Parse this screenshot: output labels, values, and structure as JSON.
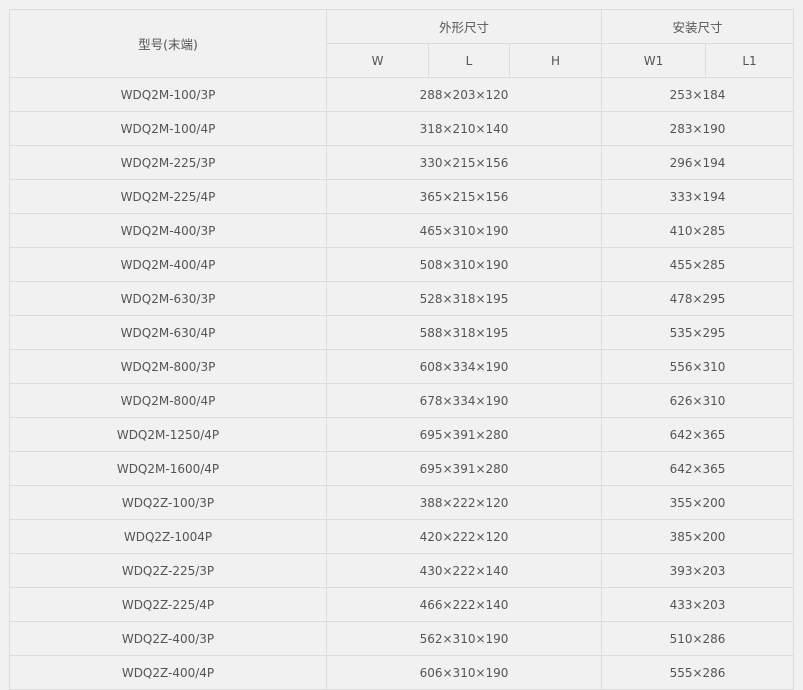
{
  "table": {
    "headers": {
      "model": "型号(末端)",
      "outer_dims": "外形尺寸",
      "install_dims": "安装尺寸",
      "w": "W",
      "l": "L",
      "h": "H",
      "w1": "W1",
      "l1": "L1"
    },
    "rows": [
      {
        "model": "WDQ2M-100/3P",
        "outer": "288×203×120",
        "install": "253×184"
      },
      {
        "model": "WDQ2M-100/4P",
        "outer": "318×210×140",
        "install": "283×190"
      },
      {
        "model": "WDQ2M-225/3P",
        "outer": "330×215×156",
        "install": "296×194"
      },
      {
        "model": "WDQ2M-225/4P",
        "outer": "365×215×156",
        "install": "333×194"
      },
      {
        "model": "WDQ2M-400/3P",
        "outer": "465×310×190",
        "install": "410×285"
      },
      {
        "model": "WDQ2M-400/4P",
        "outer": "508×310×190",
        "install": "455×285"
      },
      {
        "model": "WDQ2M-630/3P",
        "outer": "528×318×195",
        "install": "478×295"
      },
      {
        "model": "WDQ2M-630/4P",
        "outer": "588×318×195",
        "install": "535×295"
      },
      {
        "model": "WDQ2M-800/3P",
        "outer": "608×334×190",
        "install": "556×310"
      },
      {
        "model": "WDQ2M-800/4P",
        "outer": "678×334×190",
        "install": "626×310"
      },
      {
        "model": "WDQ2M-1250/4P",
        "outer": "695×391×280",
        "install": "642×365"
      },
      {
        "model": "WDQ2M-1600/4P",
        "outer": "695×391×280",
        "install": "642×365"
      },
      {
        "model": "WDQ2Z-100/3P",
        "outer": "388×222×120",
        "install": "355×200"
      },
      {
        "model": "WDQ2Z-1004P",
        "outer": "420×222×120",
        "install": "385×200"
      },
      {
        "model": "WDQ2Z-225/3P",
        "outer": "430×222×140",
        "install": "393×203"
      },
      {
        "model": "WDQ2Z-225/4P",
        "outer": "466×222×140",
        "install": "433×203"
      },
      {
        "model": "WDQ2Z-400/3P",
        "outer": "562×310×190",
        "install": "510×286"
      },
      {
        "model": "WDQ2Z-400/4P",
        "outer": "606×310×190",
        "install": "555×286"
      }
    ]
  }
}
